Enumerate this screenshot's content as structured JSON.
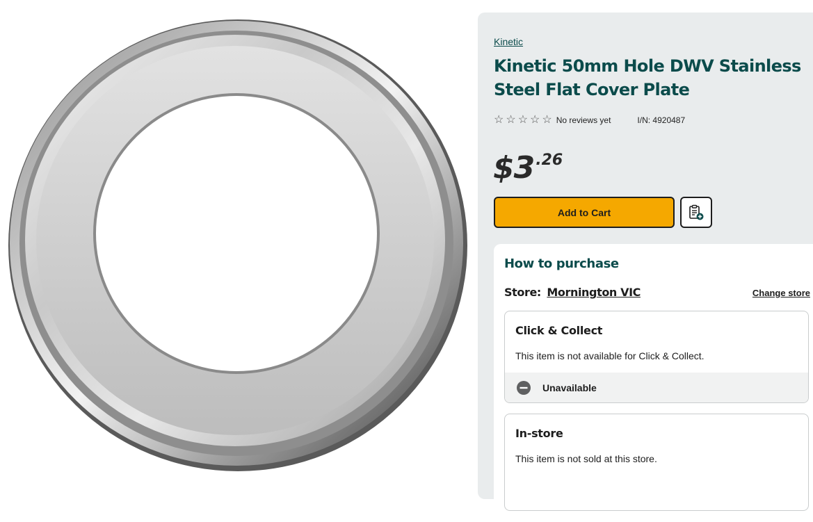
{
  "product": {
    "brand": "Kinetic",
    "title": "Kinetic 50mm Hole DWV Stainless Steel Flat Cover Plate",
    "reviews_label": "No reviews yet",
    "item_number": "I/N: 4920487",
    "rating_stars": 0,
    "rating_max": 5,
    "price_main": "$3",
    "price_cents": ".26",
    "image_icon": "steel-cover-plate-image"
  },
  "actions": {
    "add_to_cart_label": "Add to Cart",
    "list_icon": "add-to-list-icon"
  },
  "purchase": {
    "heading": "How to purchase",
    "store_label": "Store:",
    "store_name": "Mornington VIC",
    "change_store_label": "Change store",
    "click_collect": {
      "title": "Click & Collect",
      "message": "This item is not available for Click & Collect.",
      "status": "Unavailable",
      "status_icon": "minus-circle-icon"
    },
    "in_store": {
      "title": "In-store",
      "message": "This item is not sold at this store."
    }
  },
  "colors": {
    "brand_teal": "#0b4b4b",
    "cta_yellow": "#f5a800",
    "panel_bg": "#e9eced"
  }
}
